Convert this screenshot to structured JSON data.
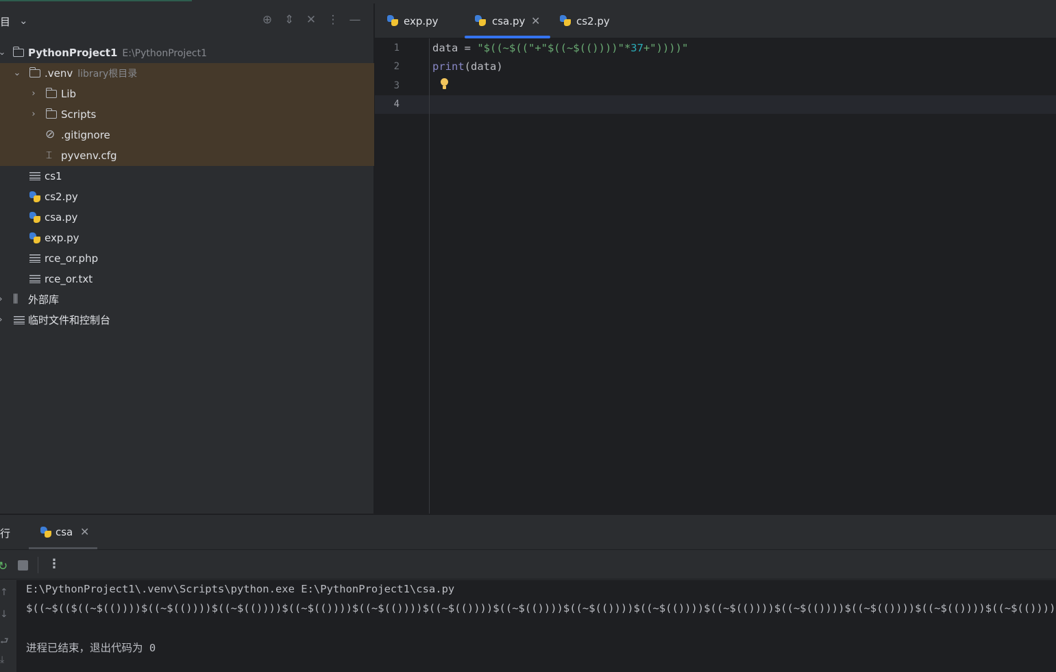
{
  "project_panel": {
    "title": "项目",
    "tree": [
      {
        "label": "PythonProject1",
        "hint": "E:\\PythonProject1"
      },
      {
        "label": ".venv",
        "hint": "library根目录"
      },
      {
        "label": "Lib"
      },
      {
        "label": "Scripts"
      },
      {
        "label": ".gitignore"
      },
      {
        "label": "pyvenv.cfg"
      },
      {
        "label": "cs1"
      },
      {
        "label": "cs2.py"
      },
      {
        "label": "csa.py"
      },
      {
        "label": "exp.py"
      },
      {
        "label": "rce_or.php"
      },
      {
        "label": "rce_or.txt"
      },
      {
        "label": "外部库"
      },
      {
        "label": "临时文件和控制台"
      }
    ]
  },
  "editor": {
    "tabs": [
      {
        "label": "exp.py"
      },
      {
        "label": "csa.py",
        "active": true
      },
      {
        "label": "cs2.py"
      }
    ],
    "line_numbers": [
      "1",
      "2",
      "3",
      "4"
    ],
    "code": {
      "l1_var": "data = ",
      "l1_str1": "\"$((~$((\"+\"$((~$(())))\"*",
      "l1_num": "37",
      "l1_str2": "+\"))))\"",
      "l2_kw": "print",
      "l2_rest": "(data)"
    }
  },
  "run_panel": {
    "title": "运行",
    "tab_label": "csa",
    "console": [
      "E:\\PythonProject1\\.venv\\Scripts\\python.exe E:\\PythonProject1\\csa.py",
      "$((~$(($((~$(())))$((~$(())))$((~$(())))$((~$(())))$((~$(())))$((~$(())))$((~$(())))$((~$(())))$((~$(())))$((~$(())))$((~$(())))$((~$(())))$((~$(())))$((~$(())))$((~$(())))",
      "进程已结束，退出代码为 0"
    ]
  },
  "colors": {
    "accent": "#3574f0",
    "venv_highlight": "#45392a",
    "string": "#6aab73",
    "number": "#2aacb8",
    "keyword": "#8888c6"
  }
}
